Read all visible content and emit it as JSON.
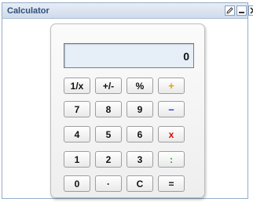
{
  "window": {
    "title": "Calculator"
  },
  "display": {
    "value": "0"
  },
  "keys": {
    "r1": [
      "1/x",
      "+/-",
      "%",
      "+"
    ],
    "r2": [
      "7",
      "8",
      "9",
      "–"
    ],
    "r3": [
      "4",
      "5",
      "6",
      "x"
    ],
    "r4": [
      "1",
      "2",
      "3",
      ":"
    ],
    "r5": [
      "0",
      "·",
      "C",
      "="
    ]
  },
  "colors": {
    "op_plus": "#e8a200",
    "op_minus": "#1b2fc8",
    "op_multiply": "#e00000",
    "op_divide": "#18a018"
  },
  "icons": {
    "edit": "pencil-icon",
    "minimize": "minimize-icon",
    "close": "close-icon"
  }
}
